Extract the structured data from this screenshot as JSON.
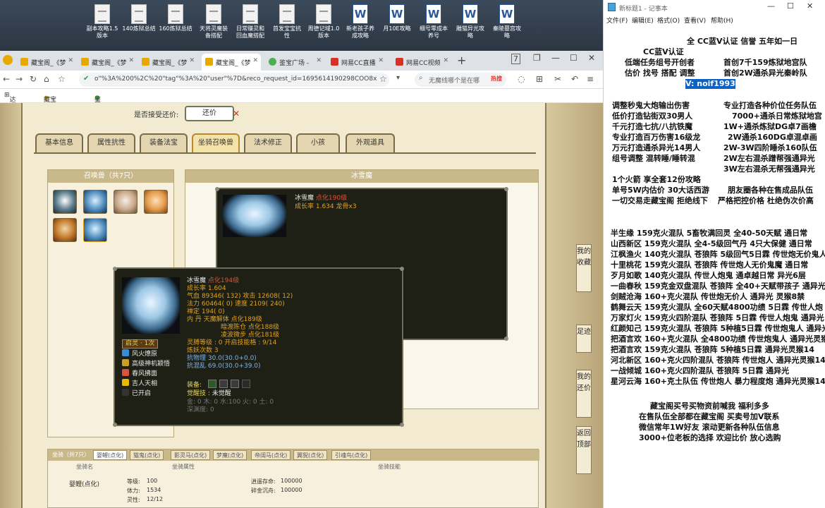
{
  "desktop_icons": [
    {
      "label": "副本攻略1.5\n版本",
      "type": "txt"
    },
    {
      "label": "140炼狱总结",
      "type": "txt"
    },
    {
      "label": "160炼狱总结",
      "type": "txt"
    },
    {
      "label": "天将灵魔装\n备搭配",
      "type": "txt"
    },
    {
      "label": "日常赚灵和\n回血魔搭配",
      "type": "txt"
    },
    {
      "label": "首发宝宝抗\n性",
      "type": "txt"
    },
    {
      "label": "周德记域1.0\n版本",
      "type": "txt"
    },
    {
      "label": "新老孩子养\n成攻略",
      "type": "word"
    },
    {
      "label": "月10E攻略",
      "type": "word"
    },
    {
      "label": "细号零成本\n养号",
      "type": "word"
    },
    {
      "label": "雕猫异光攻\n略",
      "type": "word"
    },
    {
      "label": "秦陵墓宫攻\n略",
      "type": "word"
    }
  ],
  "browser": {
    "tabs": [
      {
        "label": "藏宝阁_《梦"
      },
      {
        "label": "藏宝阁_《梦"
      },
      {
        "label": "藏宝阁_《梦"
      },
      {
        "label": "藏宝阁_《梦"
      },
      {
        "label": "鉴宝广场 -"
      },
      {
        "label": "网易CC直播"
      },
      {
        "label": "网易CC视频"
      }
    ],
    "url": "o\"%3A%200%2C%20\"tag\"%3A%20\"user\"%7D&reco_request_id=1695614190298COO8x",
    "search_placeholder": "无魔线哪个是在哪",
    "hot_label": "热搜",
    "bookmarks": [
      "达人画廊",
      "藏宝阁_《梦",
      "鉴宝广场"
    ]
  },
  "game": {
    "bargain_label": "是否接受还价:",
    "bargain_button": "还价",
    "tabs": [
      "基本信息",
      "属性抗性",
      "装备法宝",
      "坐骑召唤兽",
      "法术修正",
      "小孩",
      "外观道具"
    ],
    "pets_header": "召唤兽（共7只）",
    "preview_header": "冰雪魔",
    "preview_card": {
      "name": "冰雪魔",
      "level": "点化190级",
      "growth": "成长率 1.634 龙骨x3"
    },
    "tooltip": {
      "name": "冰雪魔",
      "level": "点化194级",
      "growth": "成长率 1.604",
      "hp": "气血 89346( 132) 攻击 12608( 12)",
      "mp": "法力 60464( 0) 速度 2109( 240)",
      "loyalty": "禅定 194( 0)",
      "inner1": "内  丹 天魔解体 点化189级",
      "inner2": "暗渡陈仓 点化188级",
      "inner3": "凌波微步 点化181级",
      "soul_label": "启灵 · 1次",
      "skills": [
        {
          "name": "风火燎原",
          "color": "#3a8bd6"
        },
        {
          "name": "高级神机颖悟",
          "color": "#c9a020"
        },
        {
          "name": "春风拂面",
          "color": "#d9533b"
        },
        {
          "name": "吉人天相",
          "color": "#e6b800"
        }
      ],
      "skill_unopened": "已开启",
      "soul_level": "灵膊等级 : 0 开启技能格 : 9/14",
      "refine": "炼妖次数 3",
      "physical": "抗物理 30.0(30.0+0.0)",
      "confuse": "抗混乱 69.0(30.0+39.0)",
      "equip_label": "装备:",
      "awaken": "觉醒技 :",
      "awaken_value": "未觉醒",
      "elements": "金: 0 木: 0 水:100 火: 0 土: 0",
      "deep": "深渊度: 0"
    },
    "mount": {
      "header": "坐骑（共7只）",
      "tabs": [
        "婴鲤(点化)",
        "猫鬼(点化)",
        "影灵马(点化)",
        "梦魔(点化)",
        "帝阔马(点化)",
        "翼猊(点化)",
        "引魂鸟(点化)"
      ],
      "col1": "坐骑名",
      "col2": "坐骑属性",
      "col3": "坐骑技能",
      "name": "婴鲤(点化)",
      "level": "等级:",
      "level_v": "100",
      "stamina": "体力:",
      "stamina_v": "1534",
      "spirit": "灵性:",
      "spirit_v": "12/12",
      "skill1": "逍遥存命:",
      "skill1_v": "100000",
      "skill2": "碎金沉舟:",
      "skill2_v": "100000"
    },
    "side_buttons": [
      "我的收藏",
      "足迹",
      "我的还价",
      "返回顶部"
    ]
  },
  "notepad": {
    "title": "新标题1 - 记事本",
    "menu": [
      "文件(F)",
      "编辑(E)",
      "格式(O)",
      "查看(V)",
      "帮助(H)"
    ],
    "lines": [
      "全  CC蓝V认证  信誉  五年如一日",
      "CC蓝V认证",
      "低端任务组号开创者",
      "首创7千159炼狱地宫队",
      "估价 找号 搭配 调整",
      "首创2W通杀异光秦岭队",
      "V:  noif1993",
      "调整秒鬼大炮输出伤害",
      "专业打造各种价位任务队伍",
      "低价打造钻街双30男人",
      "7000+通杀日常炼狱地宫",
      "千元打造七抗/八抗铁魔",
      "1W+通杀炼狱DG卓7画檐",
      "专业打造百万伤害16级龙",
      "2W通杀160DG卓混卓画",
      "万元打造通杀异光14男人",
      "2W-3W四阶睡杀160队伍",
      "组号调整 混转睡/睡转混",
      "2W左右混杀蹭帮强通异光",
      "3W左右混杀无帮强通异光",
      "1个火箭 享全套12份攻略",
      "单号5W内估价 30大话西游",
      "朋友圈各种在售成品队伍",
      "一切交易走藏宝阁 拒绝线下",
      "严格把控价格 杜绝伪次价高",
      "半生缘    159克火混队 5畜牧满回灵 全40-50天赋 通日常",
      "山西新区 159克火混队 全4-5级回气丹 4只大保健 通日常",
      "江枫渔火 140克火混队 苍狼阵  5级回气5日霖 传世炮无价鬼人",
      "十里桃花 159克火混队 苍狼阵 传世炮人无价鬼魔 通日常",
      "歹月如歌 140克火混队 传世人炮鬼 通卓越日常 异光6层",
      "一曲春秋 159克金双盘混队 苍狼阵 全40+天赋带孩子 通异光",
      "剑贼沧海 160+克火混队 传世炮无价人 通异光 灵猴8禁",
      "鹤舞云天 159克火混队 全60天赋4800功绩 5日霖 传世人炮",
      "万家灯火 159克火四阶混队 苍狼阵 5日霖 传世人炮鬼 通异光",
      "红颜知己 159克火混队 苍狼阵 5种植5日霖 传世炮鬼人 通异光",
      "把酒言欢 160+克火混队 全4800功绩 传世炮鬼人 通异光灵猴",
      "把酒言欢 159克火混队 苍狼阵 5种植5日霖 通异光灵猴14",
      "河北新区 160+克火四阶混队 苍狼阵 传世炮人 通异光灵猴14",
      "一战倾城 160+克火四阶混队 苍狼阵 5日霖 通异光",
      "星河云海 160+克土队伍 传世炮人 暴力程度炮 通异光灵猴14",
      "藏宝阁买号买物资前喊我 福利多多",
      "在售队伍全部都在藏宝阁 买卖号加V联系",
      "微信常年1W好友 滚动更新各种队伍信息",
      "3000+位老板的选择 欢迎比价 放心选购"
    ]
  }
}
